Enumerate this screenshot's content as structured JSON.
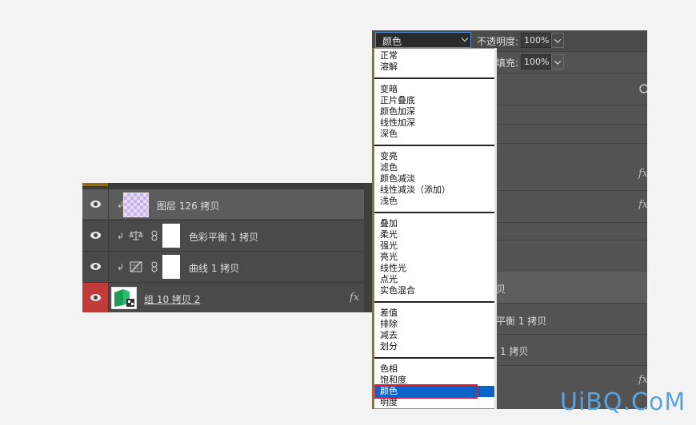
{
  "left_panel": {
    "rows": [
      {
        "name": "图层 126 拷贝",
        "selected": true
      },
      {
        "name": "色彩平衡 1 拷贝"
      },
      {
        "name": "曲线 1 拷贝"
      },
      {
        "name": "组 10 拷贝 2",
        "fx": "fx"
      }
    ]
  },
  "controls": {
    "blend_mode": "颜色",
    "opacity_label": "不透明度:",
    "opacity_value": "100%",
    "fill_label": "填充:",
    "fill_value": "100%"
  },
  "right_panel_rows": {
    "partial_text_1": "贝",
    "partial_text_2": "平衡 1 拷贝",
    "partial_text_3": "1 拷贝",
    "fx": "fx"
  },
  "blend_menu": {
    "selected": "颜色",
    "groups": [
      [
        "正常",
        "溶解"
      ],
      [
        "变暗",
        "正片叠底",
        "颜色加深",
        "线性加深",
        "深色"
      ],
      [
        "变亮",
        "滤色",
        "颜色减淡",
        "线性减淡（添加）",
        "浅色"
      ],
      [
        "叠加",
        "柔光",
        "强光",
        "亮光",
        "线性光",
        "点光",
        "实色混合"
      ],
      [
        "差值",
        "排除",
        "减去",
        "划分"
      ],
      [
        "色相",
        "饱和度",
        "颜色",
        "明度"
      ]
    ]
  },
  "watermark": "UiBQ.CoM",
  "colors": {
    "selection_blue": "#0a63c9",
    "highlight_red": "#d61f37",
    "group_eye_red": "#c23b3b",
    "watermark_blue": "#5aa3e0"
  }
}
